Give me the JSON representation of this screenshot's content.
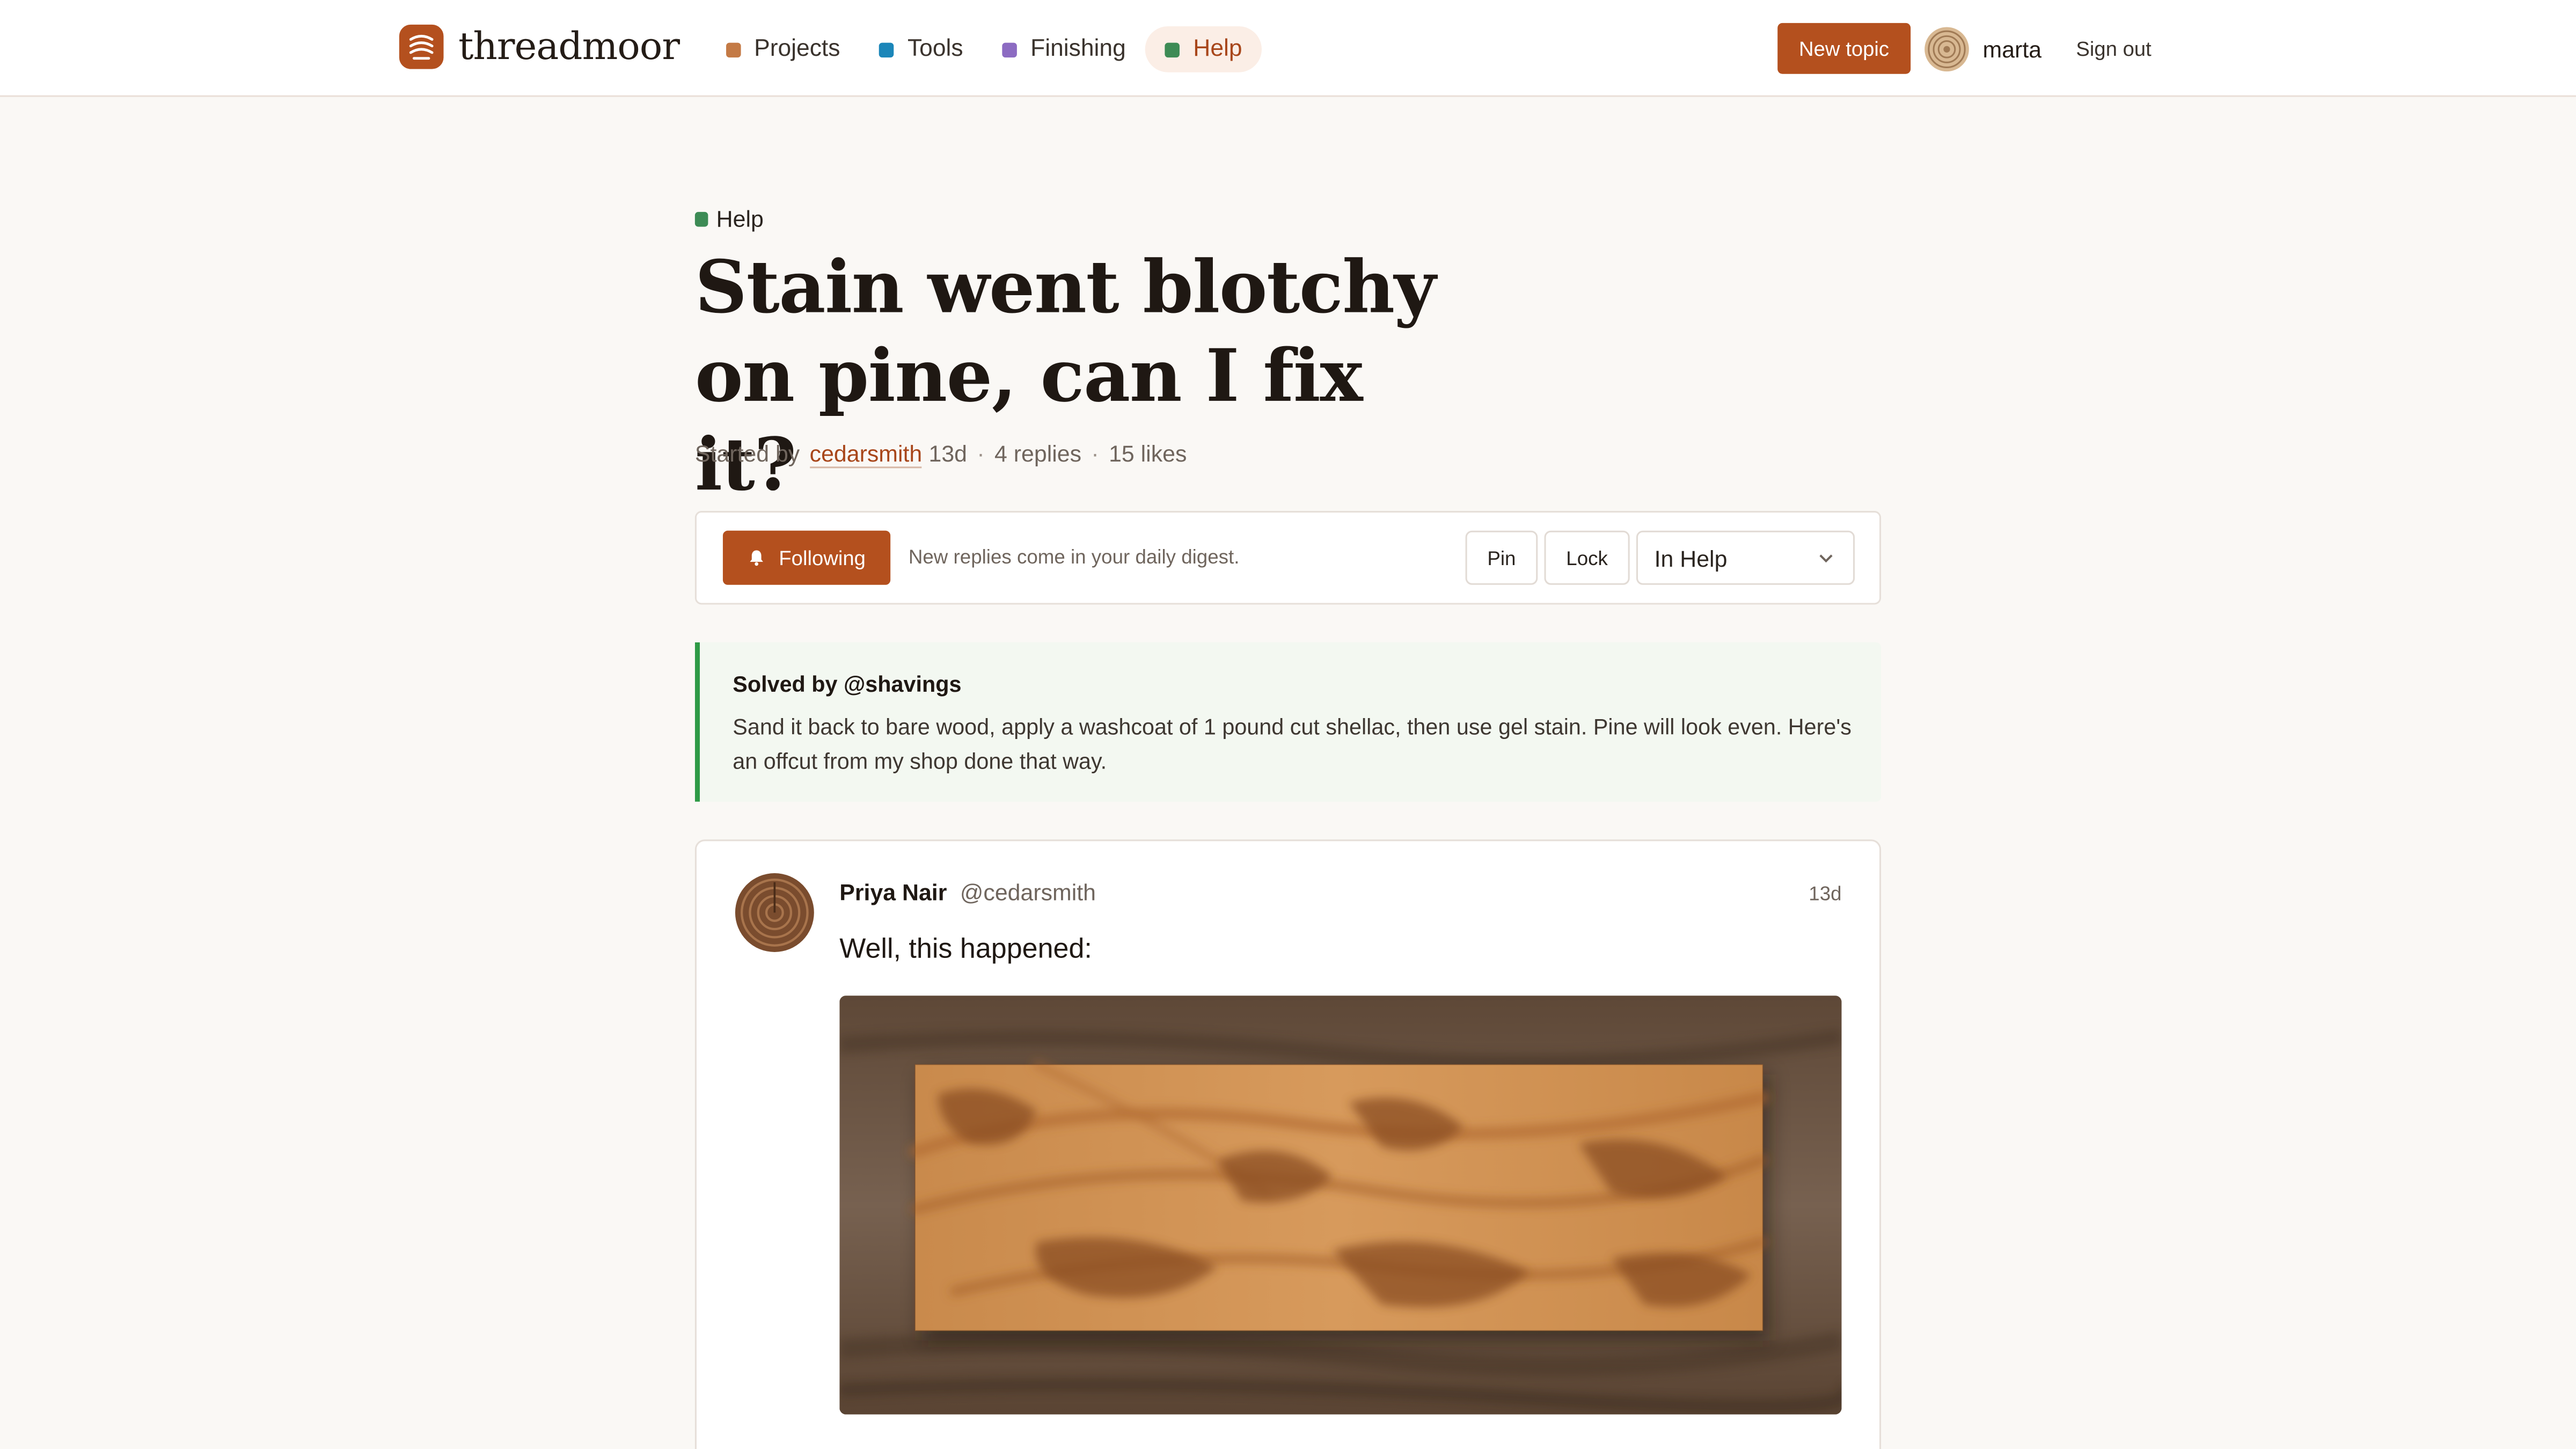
{
  "app": {
    "name": "threadmoor"
  },
  "nav": {
    "items": [
      {
        "label": "Projects",
        "color": "#c47a45"
      },
      {
        "label": "Tools",
        "color": "#1b86b9"
      },
      {
        "label": "Finishing",
        "color": "#8c6bc2"
      },
      {
        "label": "Help",
        "color": "#3d8b55",
        "active": true
      }
    ]
  },
  "header": {
    "new_topic_label": "New topic",
    "user_name": "marta",
    "sign_out_label": "Sign out"
  },
  "topic": {
    "category": "Help",
    "title": "Stain went blotchy on pine, can I fix it?",
    "started_by_prefix": "Started by",
    "author_handle": "cedarsmith",
    "age": "13d",
    "separator": "·",
    "replies": "4 replies",
    "likes": "15 likes"
  },
  "controls": {
    "follow_label": "Following",
    "follow_note": "New replies come in your daily digest.",
    "pin_label": "Pin",
    "lock_label": "Lock",
    "category_select_value": "In Help"
  },
  "solution": {
    "heading": "Solved by @shavings",
    "body": "Sand it back to bare wood, apply a washcoat of 1 pound cut shellac, then use gel stain. Pine will look even. Here's an offcut from my shop done that way."
  },
  "post": {
    "author_name": "Priya Nair",
    "author_handle": "@cedarsmith",
    "age": "13d",
    "text": "Well, this happened:"
  },
  "colors": {
    "accent": "#b4501e",
    "solved_border": "#2e9a46",
    "help_category": "#3d8b55"
  }
}
